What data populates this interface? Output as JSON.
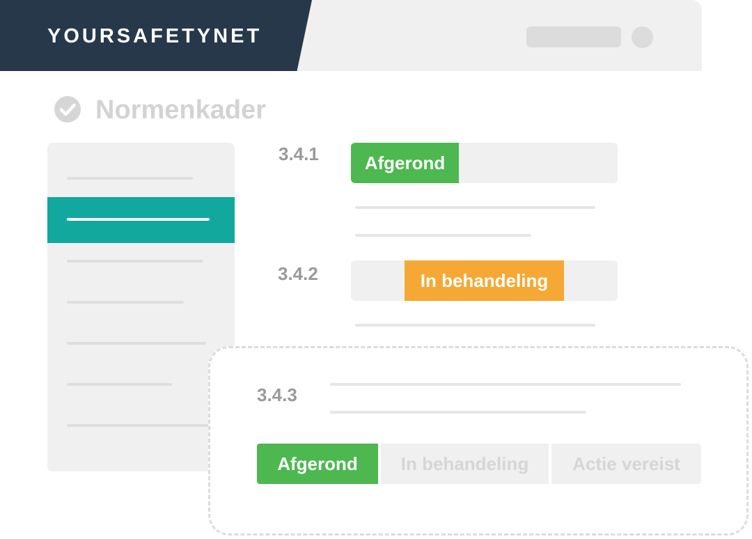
{
  "brand": {
    "name": "YOURSAFETYNET",
    "color": "#26384a"
  },
  "header": {
    "search_icon": "search-pill",
    "avatar_icon": "user-avatar"
  },
  "page": {
    "title": "Normenkader",
    "title_icon": "check-circle-icon"
  },
  "sidebar": {
    "active_color": "#13a89e",
    "active_index": 1
  },
  "items": [
    {
      "number": "3.4.1",
      "status": "Afgerond",
      "status_color": "#4cb84f"
    },
    {
      "number": "3.4.2",
      "status": "In behandeling",
      "status_color": "#f5a833"
    },
    {
      "number": "3.4.3",
      "options": [
        "Afgerond",
        "In behandeling",
        "Actie vereist"
      ],
      "selected": "Afgerond",
      "selected_color": "#4cb84f"
    }
  ]
}
